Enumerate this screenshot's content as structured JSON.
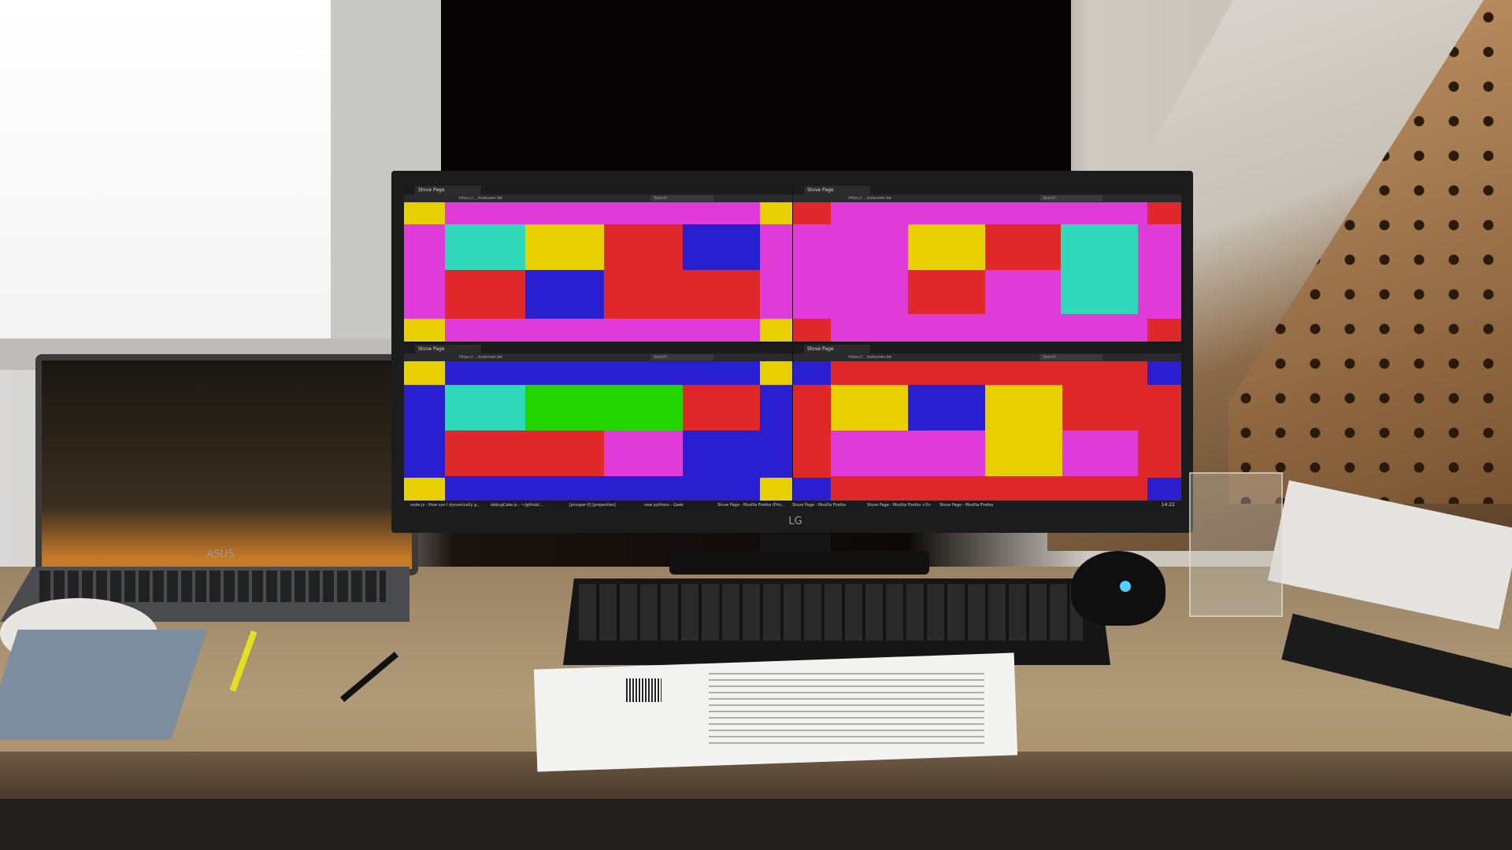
{
  "laptop": {
    "brand": "ASUS"
  },
  "monitor": {
    "brand": "LG"
  },
  "windows": [
    {
      "tab_title": "Stove Page",
      "url": "https://....kuleuven.be"
    },
    {
      "tab_title": "Stove Page",
      "url": "https://....kuleuven.be"
    },
    {
      "tab_title": "Stove Page",
      "url": "https://....kuleuven.be"
    },
    {
      "tab_title": "Stove Page",
      "url": "https://....kuleuven.be"
    }
  ],
  "search_placeholder": "Search",
  "taskbar": {
    "items": [
      "node.js - How can I dynamically g...",
      "debugCake.js - ~/github/...",
      "[prosper-0] [properties]",
      "new pythons - Geek",
      "Stove Page - Mozilla Firefox (Priv...",
      "Stove Page - Mozilla Firefox",
      "Stove Page - Mozilla Firefox <3>",
      "Stove Page - Mozilla Firefox"
    ],
    "clock": "14:22"
  },
  "colors": {
    "magenta": "#e03ad8",
    "yellow": "#e8d000",
    "teal": "#2ed8b8",
    "red": "#e0282a",
    "blue": "#2a1fd0",
    "green": "#22d400"
  }
}
